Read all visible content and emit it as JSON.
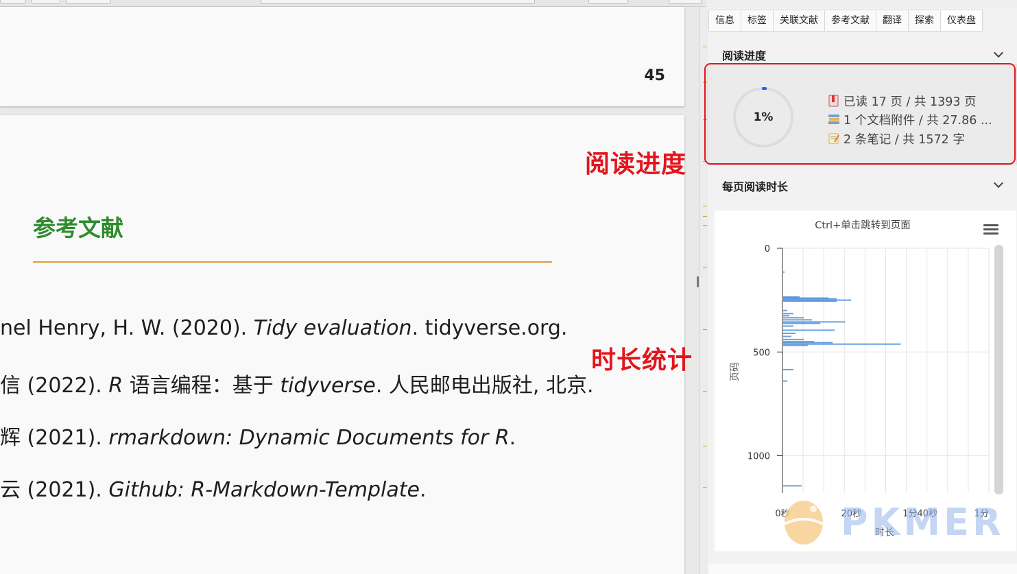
{
  "viewer": {
    "page_number": "45",
    "references_heading": "参考文献",
    "references": [
      {
        "plain": "nel Henry, H. W. (2020). ",
        "italic": "Tidy evaluation",
        "rest": ". tidyverse.org."
      },
      {
        "plain": "信 (2022). ",
        "italic": "R",
        "rest": " 语言编程：基于 ",
        "italic2": "tidyverse",
        "rest2": ". 人民邮电出版社, 北京."
      },
      {
        "plain": "辉 (2021). ",
        "italic": "rmarkdown: Dynamic Documents for R",
        "rest": "."
      },
      {
        "plain": "云 (2021). ",
        "italic": "Github: R-Markdown-Template",
        "rest": "."
      }
    ]
  },
  "annotations": {
    "progress_label": "阅读进度",
    "duration_label": "时长统计"
  },
  "panel": {
    "tabs": [
      "信息",
      "标签",
      "关联文献",
      "参考文献",
      "翻译",
      "探索",
      "仪表盘"
    ],
    "progress_section": {
      "title": "阅读进度",
      "percent_text": "1%",
      "percent_value": 1,
      "pages_read": "已读 17 页 / 共 1393 页",
      "attachments": "1 个文档附件 / 共 27.86 ...",
      "notes": "2 条笔记 / 共 1572 字"
    },
    "duration_section": {
      "title": "每页阅读时长"
    }
  },
  "chart_data": {
    "type": "bar",
    "orientation": "horizontal",
    "title": "Ctrl+单击跳转到页面",
    "xlabel": "时长",
    "ylabel": "页码",
    "x_ticks": [
      "0秒",
      "20秒",
      "1分40秒",
      "1分"
    ],
    "y_ticks": [
      "0",
      "500",
      "1000"
    ],
    "ylim": [
      0,
      1180
    ],
    "xlim": [
      0,
      100
    ],
    "color": "#4f8fd6",
    "bars": [
      {
        "page": 115,
        "value": 0.5
      },
      {
        "page": 235,
        "value": 8
      },
      {
        "page": 240,
        "value": 22
      },
      {
        "page": 244,
        "value": 26
      },
      {
        "page": 250,
        "value": 33
      },
      {
        "page": 255,
        "value": 26
      },
      {
        "page": 300,
        "value": 2
      },
      {
        "page": 315,
        "value": 5
      },
      {
        "page": 325,
        "value": 3
      },
      {
        "page": 335,
        "value": 10
      },
      {
        "page": 345,
        "value": 14
      },
      {
        "page": 355,
        "value": 30
      },
      {
        "page": 362,
        "value": 18
      },
      {
        "page": 375,
        "value": 5
      },
      {
        "page": 395,
        "value": 25
      },
      {
        "page": 410,
        "value": 6
      },
      {
        "page": 425,
        "value": 4
      },
      {
        "page": 440,
        "value": 10
      },
      {
        "page": 450,
        "value": 15
      },
      {
        "page": 455,
        "value": 24
      },
      {
        "page": 462,
        "value": 57
      },
      {
        "page": 468,
        "value": 12
      },
      {
        "page": 585,
        "value": 5
      },
      {
        "page": 640,
        "value": 2
      },
      {
        "page": 1145,
        "value": 9
      }
    ]
  },
  "watermark": "PKMER"
}
